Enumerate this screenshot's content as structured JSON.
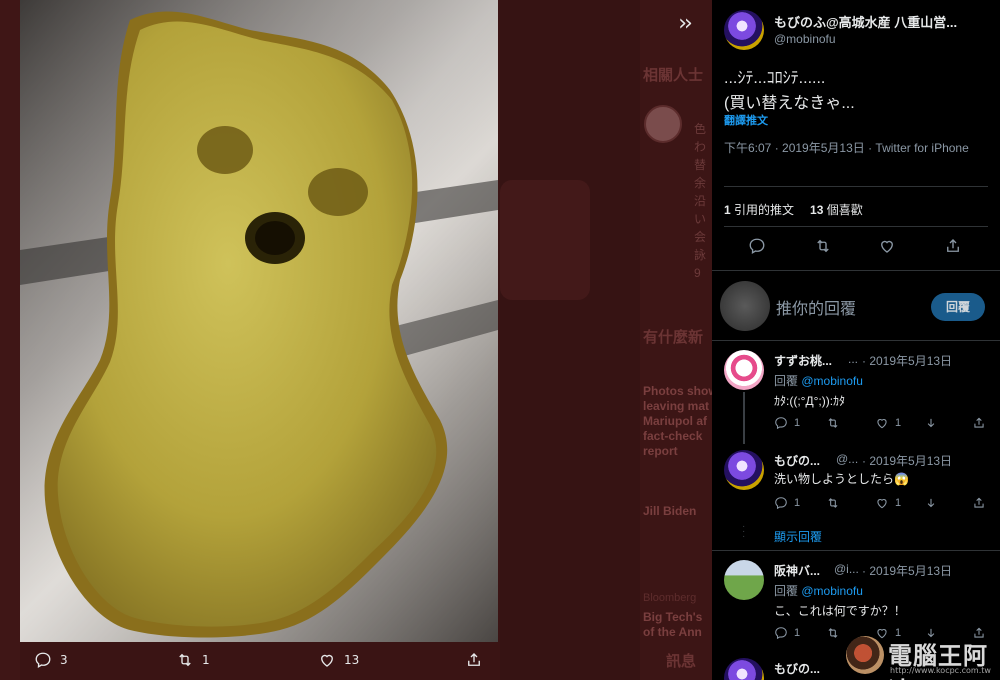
{
  "background": {
    "trends_heading": "相關人士",
    "news_heading": "有什麼新",
    "lines_column": "色\nわ\n替\n余\n沿\nい\n会\n詠\n9",
    "news_text": "Photos show\nleaving mat\nMariupol af\nfact-check\nreport",
    "item_jill": "Jill Biden",
    "item_bloomberg": "Bloomberg",
    "item_bigtech": "Big Tech's\nof the Ann",
    "messages_label": "訊息"
  },
  "photo": {
    "alt": "yellow sponge ghost",
    "actions": {
      "reply_count": "3",
      "retweet_count": "1",
      "like_count": "13"
    }
  },
  "tweet": {
    "author_name": "もびのふ@高城水産 八重山営...",
    "author_handle": "@mobinofu",
    "text": "...ｼﾃ...ｺﾛｼﾃ......\n(買い替えなきゃ...",
    "translate_label": "翻譯推文",
    "timestamp": "下午6:07 · 2019年5月13日 · ",
    "source": "Twitter for iPhone",
    "quote_count": "1",
    "quote_label": "引用的推文",
    "like_count": "13",
    "like_label": "個喜歡"
  },
  "reply_box": {
    "placeholder": "推你的回覆",
    "button_label": "回覆"
  },
  "replies": [
    {
      "name": "すずお桃...",
      "dots": "...",
      "date": "· 2019年5月13日",
      "to_prefix": "回覆 ",
      "to_handle": "@mobinofu",
      "text": "ｶﾀ:((;°Д°;)):ｶﾀ",
      "reply_count": "1",
      "like_count": "1"
    },
    {
      "name": "もびの...",
      "handle": "@...",
      "date": "· 2019年5月13日",
      "text": "洗い物しようとしたら😱",
      "reply_count": "1",
      "like_count": "1"
    },
    {
      "name": "阪神バ...",
      "handle": "@i...",
      "date": "· 2019年5月13日",
      "to_prefix": "回覆 ",
      "to_handle": "@mobinofu",
      "text": "こ、これは何ですか？！",
      "reply_count": "1",
      "like_count": "1"
    },
    {
      "name": "もびの..."
    }
  ],
  "show_replies_label": "顯示回覆",
  "watermark": {
    "text": "電腦王阿達",
    "url": "http://www.kocpc.com.tw"
  }
}
